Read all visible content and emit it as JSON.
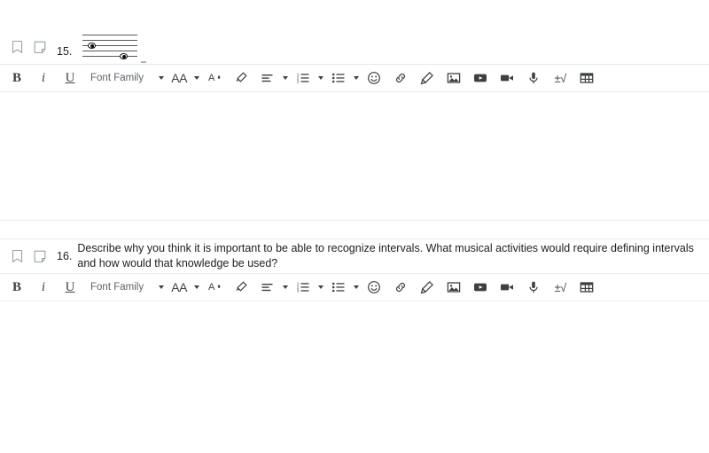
{
  "questions": [
    {
      "number": "15.",
      "text": "",
      "bookmark_icon": "bookmark-icon",
      "note_icon": "sticky-note-icon",
      "notation": {
        "type": "music-staff",
        "staff_lines": 5,
        "notes": [
          {
            "label": "whole-note",
            "line": 3
          },
          {
            "label": "whole-note",
            "line": 5
          }
        ]
      }
    },
    {
      "number": "16.",
      "text": "Describe why you think it is important to be able to recognize intervals. What musical activities would require defining intervals and how would that knowledge be used?",
      "bookmark_icon": "bookmark-icon",
      "note_icon": "sticky-note-icon"
    }
  ],
  "toolbar": {
    "bold_label": "B",
    "italic_label": "i",
    "underline_label": "U",
    "font_family_label": "Font Family",
    "font_size_label": "AA",
    "math_label": "±√",
    "items": [
      {
        "name": "bold-button",
        "label": "B"
      },
      {
        "name": "italic-button",
        "label": "i"
      },
      {
        "name": "underline-button",
        "label": "U"
      },
      {
        "name": "font-family-select",
        "label": "Font Family"
      },
      {
        "name": "font-size-button",
        "label": "AA"
      },
      {
        "name": "font-color-button",
        "label": "font-color-icon"
      },
      {
        "name": "highlight-button",
        "label": "highlighter-icon"
      },
      {
        "name": "align-button",
        "label": "align-left-icon"
      },
      {
        "name": "numbered-list-button",
        "label": "numbered-list-icon"
      },
      {
        "name": "bulleted-list-button",
        "label": "bulleted-list-icon"
      },
      {
        "name": "emoji-button",
        "label": "emoji-icon"
      },
      {
        "name": "link-button",
        "label": "link-icon"
      },
      {
        "name": "pencil-button",
        "label": "pencil-icon"
      },
      {
        "name": "image-button",
        "label": "image-icon"
      },
      {
        "name": "youtube-button",
        "label": "youtube-icon"
      },
      {
        "name": "video-button",
        "label": "video-camera-icon"
      },
      {
        "name": "microphone-button",
        "label": "microphone-icon"
      },
      {
        "name": "math-button",
        "label": "±√"
      },
      {
        "name": "table-button",
        "label": "table-icon"
      }
    ]
  },
  "colors": {
    "border": "#e8eaed",
    "text": "#202124",
    "muted_text": "#5f6368",
    "icon": "#3c4043",
    "staff_line": "#58595b"
  }
}
